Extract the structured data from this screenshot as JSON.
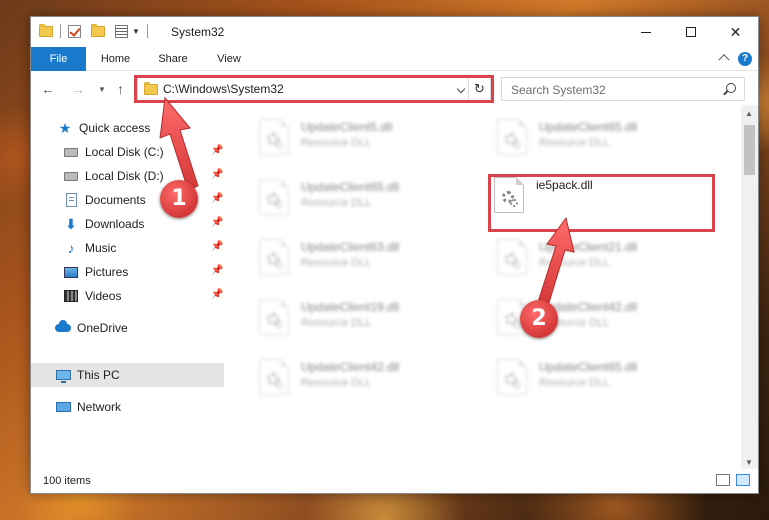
{
  "window": {
    "title": "System32",
    "controls": {
      "minimize": "minimize",
      "maximize": "maximize",
      "close": "✕"
    }
  },
  "ribbon": {
    "tabs": [
      "File",
      "Home",
      "Share",
      "View"
    ],
    "help": "?"
  },
  "nav": {
    "address": "C:\\Windows\\System32",
    "search_placeholder": "Search System32"
  },
  "sidebar": {
    "items": [
      {
        "label": "Quick access",
        "icon": "star-icon",
        "pinned": false
      },
      {
        "label": "Local Disk (C:)",
        "icon": "disk-icon",
        "pinned": true
      },
      {
        "label": "Local Disk (D:)",
        "icon": "disk-icon",
        "pinned": true
      },
      {
        "label": "Documents",
        "icon": "documents-icon",
        "pinned": true
      },
      {
        "label": "Downloads",
        "icon": "download-icon",
        "pinned": true
      },
      {
        "label": "Music",
        "icon": "music-icon",
        "pinned": true
      },
      {
        "label": "Pictures",
        "icon": "pictures-icon",
        "pinned": true
      },
      {
        "label": "Videos",
        "icon": "videos-icon",
        "pinned": true
      },
      {
        "label": "OneDrive",
        "icon": "onedrive-icon",
        "pinned": false
      },
      {
        "label": "This PC",
        "icon": "this-pc-icon",
        "pinned": false,
        "selected": true
      },
      {
        "label": "Network",
        "icon": "network-icon",
        "pinned": false
      }
    ]
  },
  "files": [
    {
      "name": "UpdateClient5.dll",
      "type": "Resource DLL",
      "blurred": true
    },
    {
      "name": "UpdateClient65.dll",
      "type": "Resource DLL",
      "blurred": true
    },
    {
      "name": "UpdateClient65.dll",
      "type": "Resource DLL",
      "blurred": true
    },
    {
      "name": "ie5pack.dll",
      "type": "",
      "blurred": false
    },
    {
      "name": "UpdateClient63.dll",
      "type": "Resource DLL",
      "blurred": true
    },
    {
      "name": "UpdateClient21.dll",
      "type": "Resource DLL",
      "blurred": true
    },
    {
      "name": "UpdateClient19.dll",
      "type": "Resource DLL",
      "blurred": true
    },
    {
      "name": "UpdateClient42.dll",
      "type": "Resource DLL",
      "blurred": true
    },
    {
      "name": "UpdateClient42.dll",
      "type": "Resource DLL",
      "blurred": true
    },
    {
      "name": "UpdateClient65.dll",
      "type": "Resource DLL",
      "blurred": true
    }
  ],
  "status": {
    "count": "100 items"
  },
  "annotations": {
    "step1": "1",
    "step2": "2"
  },
  "colors": {
    "accent": "#1979ca",
    "highlight": "#d9434b"
  }
}
